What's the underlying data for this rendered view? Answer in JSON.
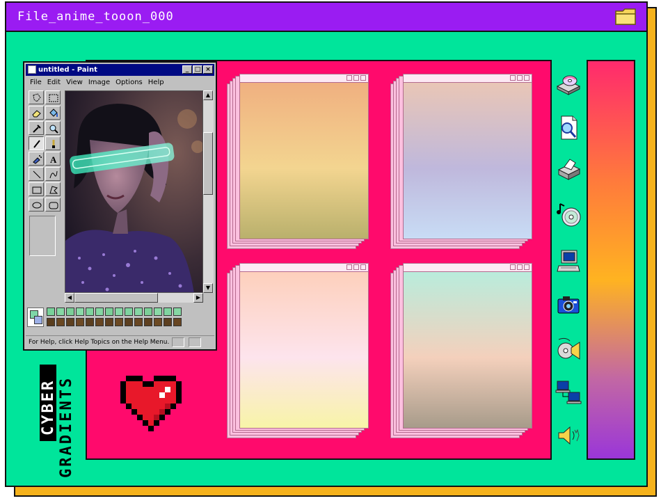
{
  "window": {
    "title": "File_anime_tooon_000"
  },
  "paint": {
    "title": "untitled - Paint",
    "menus": [
      "File",
      "Edit",
      "View",
      "Image",
      "Options",
      "Help"
    ],
    "status": "For Help, click Help Topics on the Help Menu."
  },
  "badge": {
    "line1": "CYBER",
    "line2": "GRADIENTS"
  },
  "gradients": [
    {
      "top": "#f0b080",
      "mid": "#f3d590",
      "bottom": "#b9b06c"
    },
    {
      "top": "#e9c6b6",
      "mid": "#bfb8dc",
      "bottom": "#c8dcf5"
    },
    {
      "top": "#fdd0bc",
      "mid": "#fde4ed",
      "bottom": "#f8f4a8"
    },
    {
      "top": "#b9ecdc",
      "mid": "#f4d0bc",
      "bottom": "#a79b8a"
    }
  ],
  "colors": {
    "background": "#00e59b",
    "titlebar": "#9a1cf2",
    "stage": "#ff0a6c",
    "shadow": "#f5b21c"
  },
  "icons": [
    "cd-drive-icon",
    "find-file-icon",
    "printer-icon",
    "music-cd-icon",
    "computer-icon",
    "camera-icon",
    "media-player-icon",
    "network-icon",
    "speaker-icon"
  ]
}
